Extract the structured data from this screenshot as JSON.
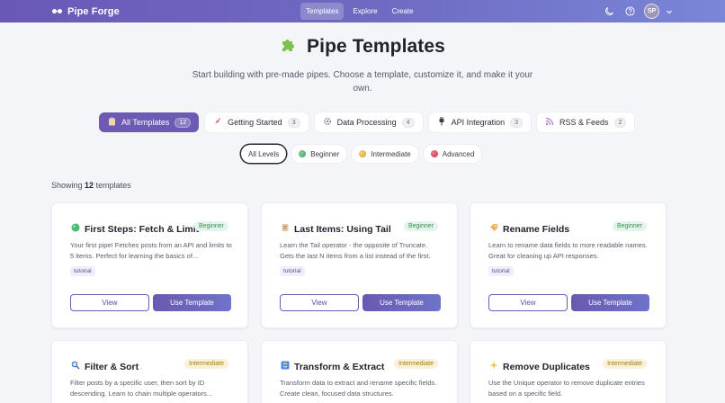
{
  "app": {
    "name": "Pipe Forge"
  },
  "nav": [
    {
      "label": "Templates",
      "active": true
    },
    {
      "label": "Explore",
      "active": false
    },
    {
      "label": "Create",
      "active": false
    }
  ],
  "user": {
    "initials": "SP"
  },
  "icons": {
    "theme": "moon-icon",
    "help": "help-circle-icon",
    "menu": "chevron-down-icon"
  },
  "hero": {
    "title": "Pipe Templates",
    "subtitle": "Start building with pre-made pipes. Choose a template, customize it, and make it your own."
  },
  "categories": [
    {
      "label": "All Templates",
      "count": "12",
      "icon": "clipboard-icon",
      "active": true
    },
    {
      "label": "Getting Started",
      "count": "3",
      "icon": "rocket-icon",
      "active": false
    },
    {
      "label": "Data Processing",
      "count": "4",
      "icon": "gear-icon",
      "active": false
    },
    {
      "label": "API Integration",
      "count": "3",
      "icon": "plug-icon",
      "active": false
    },
    {
      "label": "RSS & Feeds",
      "count": "2",
      "icon": "rss-icon",
      "active": false
    }
  ],
  "levels": [
    {
      "label": "All Levels",
      "active": true
    },
    {
      "label": "Beginner",
      "color": "#4caf74"
    },
    {
      "label": "Intermediate",
      "color": "#e8b53a"
    },
    {
      "label": "Advanced",
      "color": "#d9475a"
    }
  ],
  "showing": {
    "prefix": "Showing",
    "count": "12",
    "suffix": "templates"
  },
  "buttons": {
    "view": "View",
    "use": "Use Template"
  },
  "cards": [
    {
      "title": "First Steps: Fetch & Limit",
      "icon": "green-circle-icon",
      "level": "Beginner",
      "description": "Your first pipe! Fetches posts from an API and limits to 5 items. Perfect for learning the basics of...",
      "tag": "tutorial"
    },
    {
      "title": "Last Items: Using Tail",
      "icon": "scroll-icon",
      "level": "Beginner",
      "description": "Learn the Tail operator - the opposite of Truncate. Gets the last N items from a list instead of the first.",
      "tag": "tutorial"
    },
    {
      "title": "Rename Fields",
      "icon": "label-icon",
      "level": "Beginner",
      "description": "Learn to rename data fields to more readable names. Great for cleaning up API responses.",
      "tag": "tutorial"
    },
    {
      "title": "Filter & Sort",
      "icon": "magnifier-icon",
      "level": "Intermediate",
      "description": "Filter posts by a specific user, then sort by ID descending. Learn to chain multiple operators..."
    },
    {
      "title": "Transform & Extract",
      "icon": "refresh-icon",
      "level": "Intermediate",
      "description": "Transform data to extract and rename specific fields. Create clean, focused data structures."
    },
    {
      "title": "Remove Duplicates",
      "icon": "sparkle-icon",
      "level": "Intermediate",
      "description": "Use the Unique operator to remove duplicate entries based on a specific field."
    }
  ]
}
